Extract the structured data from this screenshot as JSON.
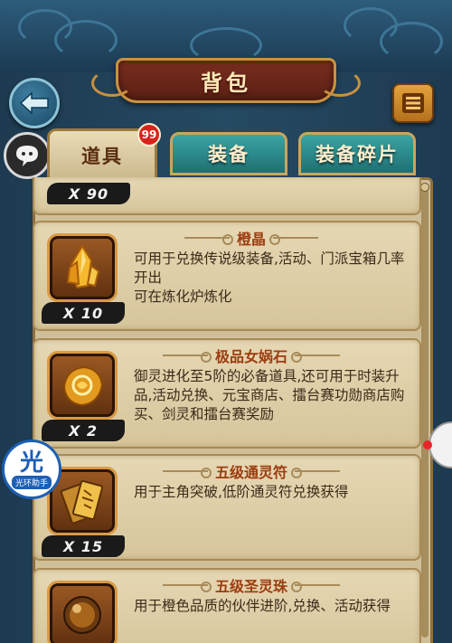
{
  "header": {
    "title": "背包"
  },
  "tabs": [
    {
      "label": "道具",
      "active": true,
      "badge": "99"
    },
    {
      "label": "装备",
      "active": false
    },
    {
      "label": "装备碎片",
      "active": false
    }
  ],
  "items": [
    {
      "name": "",
      "count": "X 90",
      "description": ""
    },
    {
      "name": "橙晶",
      "count": "X 10",
      "icon": "orange-crystal-icon",
      "description": "可用于兑换传说级装备,活动、门派宝箱几率开出\n可在炼化炉炼化"
    },
    {
      "name": "极品女娲石",
      "count": "X 2",
      "icon": "nuwa-stone-icon",
      "description": "御灵进化至5阶的必备道具,还可用于时装升品,活动兑换、元宝商店、擂台赛功勋商店购买、剑灵和擂台赛奖励"
    },
    {
      "name": "五级通灵符",
      "count": "X 15",
      "icon": "spirit-talisman-icon",
      "description": "用于主角突破,低阶通灵符兑换获得"
    },
    {
      "name": "五级圣灵珠",
      "count": "",
      "icon": "holy-pearl-icon",
      "description": "用于橙色品质的伙伴进阶,兑换、活动获得"
    }
  ],
  "helper": {
    "big": "光",
    "small": "光环助手"
  },
  "colors": {
    "panel": "#cfbf98",
    "tab_active": "#eadcb8",
    "tab_inactive": "#2c8c8c",
    "badge": "#d8231d",
    "item_name": "#9c3d10"
  }
}
